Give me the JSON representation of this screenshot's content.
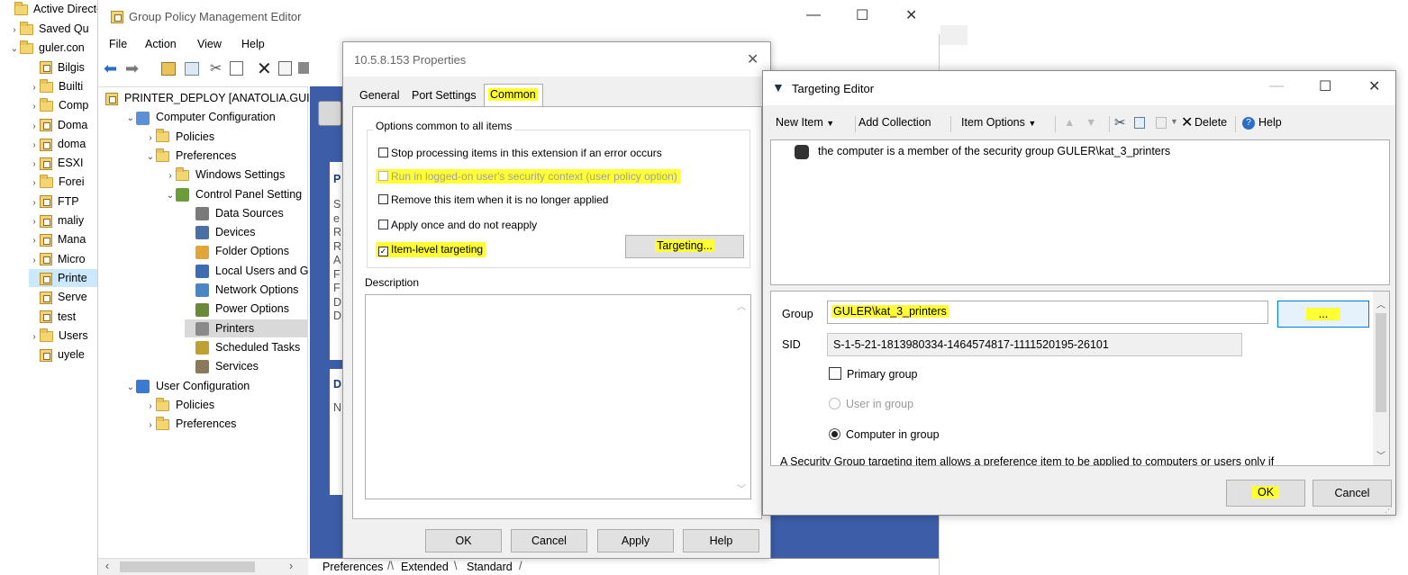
{
  "left_tree": {
    "items": [
      {
        "label": "Active Directory",
        "chev": "",
        "icon": "folder"
      },
      {
        "label": "Saved Qu",
        "chev": "›",
        "icon": "folder"
      },
      {
        "label": "guler.con",
        "chev": "⌄",
        "icon": "domain"
      },
      {
        "label": "Bilgis",
        "chev": "",
        "icon": "gpo"
      },
      {
        "label": "Builti",
        "chev": "›",
        "icon": "folder"
      },
      {
        "label": "Comp",
        "chev": "›",
        "icon": "folder"
      },
      {
        "label": "Doma",
        "chev": "›",
        "icon": "gpo"
      },
      {
        "label": "doma",
        "chev": "›",
        "icon": "gpo"
      },
      {
        "label": "ESXI",
        "chev": "›",
        "icon": "gpo"
      },
      {
        "label": "Forei",
        "chev": "›",
        "icon": "folder"
      },
      {
        "label": "FTP",
        "chev": "›",
        "icon": "gpo"
      },
      {
        "label": "maliy",
        "chev": "›",
        "icon": "gpo"
      },
      {
        "label": "Mana",
        "chev": "›",
        "icon": "gpo"
      },
      {
        "label": "Micro",
        "chev": "›",
        "icon": "gpo"
      },
      {
        "label": "Printe",
        "chev": "",
        "icon": "gpo"
      },
      {
        "label": "Serve",
        "chev": "",
        "icon": "gpo"
      },
      {
        "label": "test",
        "chev": "",
        "icon": "gpo"
      },
      {
        "label": "Users",
        "chev": "›",
        "icon": "folder"
      },
      {
        "label": "uyele",
        "chev": "",
        "icon": "gpo"
      }
    ]
  },
  "gpme": {
    "title": "Group Policy Management Editor",
    "menu": [
      "File",
      "Action",
      "View",
      "Help"
    ],
    "tree": [
      {
        "label": "PRINTER_DEPLOY [ANATOLIA.GUI",
        "indent": 0,
        "chev": "",
        "icon": "gpo"
      },
      {
        "label": "Computer Configuration",
        "indent": 1,
        "chev": "⌄",
        "icon": "computer"
      },
      {
        "label": "Policies",
        "indent": 2,
        "chev": "›",
        "icon": "folder"
      },
      {
        "label": "Preferences",
        "indent": 2,
        "chev": "⌄",
        "icon": "folder"
      },
      {
        "label": "Windows Settings",
        "indent": 3,
        "chev": "›",
        "icon": "folder"
      },
      {
        "label": "Control Panel Setting",
        "indent": 3,
        "chev": "⌄",
        "icon": "cpanel"
      },
      {
        "label": "Data Sources",
        "indent": 4,
        "chev": "",
        "icon": "data"
      },
      {
        "label": "Devices",
        "indent": 4,
        "chev": "",
        "icon": "device"
      },
      {
        "label": "Folder Options",
        "indent": 4,
        "chev": "",
        "icon": "folderopt"
      },
      {
        "label": "Local Users and G",
        "indent": 4,
        "chev": "",
        "icon": "users"
      },
      {
        "label": "Network Options",
        "indent": 4,
        "chev": "",
        "icon": "network"
      },
      {
        "label": "Power Options",
        "indent": 4,
        "chev": "",
        "icon": "power"
      },
      {
        "label": "Printers",
        "indent": 4,
        "chev": "",
        "icon": "printer",
        "selected": true
      },
      {
        "label": "Scheduled Tasks",
        "indent": 4,
        "chev": "",
        "icon": "task"
      },
      {
        "label": "Services",
        "indent": 4,
        "chev": "",
        "icon": "services"
      },
      {
        "label": "User Configuration",
        "indent": 1,
        "chev": "⌄",
        "icon": "user"
      },
      {
        "label": "Policies",
        "indent": 2,
        "chev": "›",
        "icon": "folder"
      },
      {
        "label": "Preferences",
        "indent": 2,
        "chev": "›",
        "icon": "folder"
      }
    ],
    "bottom_tabs": [
      "Preferences",
      "Extended",
      "Standard"
    ],
    "right_letters": [
      "P",
      "S",
      "e",
      "R",
      "R",
      "A",
      "F",
      "F",
      "D",
      "D"
    ],
    "right_letters2": [
      "D",
      "N"
    ]
  },
  "props": {
    "title": "10.5.8.153 Properties",
    "tabs": [
      "General",
      "Port Settings",
      "Common"
    ],
    "group_title": "Options common to all items",
    "options": [
      {
        "label": "Stop processing items in this extension if an error occurs",
        "checked": false,
        "disabled": false,
        "highlight": false
      },
      {
        "label": "Run in logged-on user's security context (user policy option)",
        "checked": false,
        "disabled": true,
        "highlight": true
      },
      {
        "label": "Remove this item when it is no longer applied",
        "checked": false,
        "disabled": false,
        "highlight": false
      },
      {
        "label": "Apply once and do not reapply",
        "checked": false,
        "disabled": false,
        "highlight": false
      },
      {
        "label": "Item-level targeting",
        "checked": true,
        "disabled": false,
        "highlight": true
      }
    ],
    "targeting_btn": "Targeting...",
    "description_label": "Description",
    "buttons": {
      "ok": "OK",
      "cancel": "Cancel",
      "apply": "Apply",
      "help": "Help"
    }
  },
  "targeting": {
    "title": "Targeting Editor",
    "toolbar": {
      "new_item": "New Item",
      "add_collection": "Add Collection",
      "item_options": "Item Options",
      "delete": "Delete",
      "help": "Help"
    },
    "rule_text": "the computer is a member of the security group GULER\\kat_3_printers",
    "group_label": "Group",
    "group_value": "GULER\\kat_3_printers",
    "browse_label": "...",
    "sid_label": "SID",
    "sid_value": "S-1-5-21-1813980334-1464574817-1111520195-26101",
    "primary_group": "Primary group",
    "user_in_group": "User in group",
    "computer_in_group": "Computer in group",
    "description": "A Security Group targeting item allows a preference item to be applied to computers or users only if",
    "ok": "OK",
    "cancel": "Cancel"
  }
}
